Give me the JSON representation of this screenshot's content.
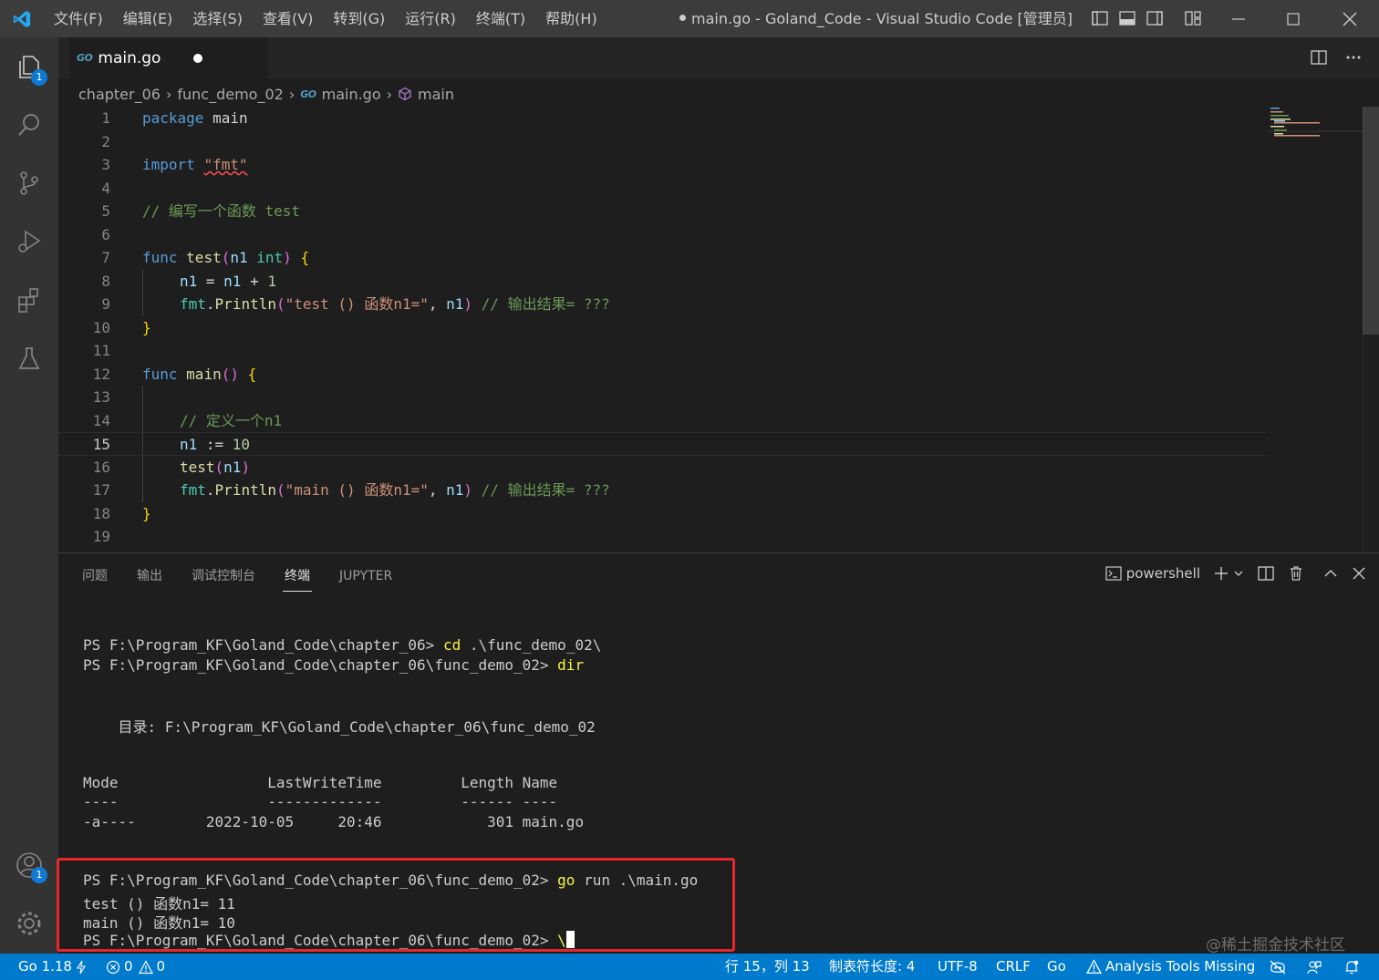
{
  "titlebar": {
    "menus": [
      "文件(F)",
      "编辑(E)",
      "选择(S)",
      "查看(V)",
      "转到(G)",
      "运行(R)",
      "终端(T)",
      "帮助(H)"
    ],
    "window_title": "main.go - Goland_Code - Visual Studio Code [管理员]"
  },
  "activity": {
    "explorer_badge": "1",
    "accounts_badge": "1"
  },
  "tab": {
    "icon_text": "GO",
    "label": "main.go"
  },
  "breadcrumb": {
    "items": [
      "chapter_06",
      "func_demo_02",
      "main.go",
      "main"
    ]
  },
  "code": {
    "line_numbers": [
      "1",
      "2",
      "3",
      "4",
      "5",
      "6",
      "7",
      "8",
      "9",
      "10",
      "11",
      "12",
      "13",
      "14",
      "15",
      "16",
      "17",
      "18",
      "19"
    ],
    "current_line": "15",
    "l1_kw": "package",
    "l1_name": "main",
    "l3_kw": "import",
    "l3_str": "\"fmt\"",
    "l5_comment": "// 编写一个函数 test",
    "l7_kw": "func",
    "l7_fn": "test",
    "l7_p1": "(",
    "l7_var": "n1",
    "l7_ty": "int",
    "l7_p2": ")",
    "l7_brace": "{",
    "l8_var1": "n1",
    "l8_op1": " = ",
    "l8_var2": "n1",
    "l8_op2": " + ",
    "l8_num": "1",
    "l9_pkg": "fmt",
    "l9_dot": ".",
    "l9_fn": "Println",
    "l9_p1": "(",
    "l9_str": "\"test () 函数n1=\"",
    "l9_comma": ", ",
    "l9_var": "n1",
    "l9_p2": ")",
    "l9_comment": "// 输出结果= ???",
    "l10_brace": "}",
    "l12_kw": "func",
    "l12_fn": "main",
    "l12_parens": "()",
    "l12_brace": "{",
    "l14_comment": "// 定义一个n1",
    "l15_var": "n1",
    "l15_op": " := ",
    "l15_num": "10",
    "l16_fn": "test",
    "l16_p1": "(",
    "l16_var": "n1",
    "l16_p2": ")",
    "l17_pkg": "fmt",
    "l17_dot": ".",
    "l17_fn": "Println",
    "l17_p1": "(",
    "l17_str": "\"main () 函数n1=\"",
    "l17_comma": ", ",
    "l17_var": "n1",
    "l17_p2": ")",
    "l17_comment": "// 输出结果= ???",
    "l18_brace": "}"
  },
  "panel": {
    "tabs": [
      "问题",
      "输出",
      "调试控制台",
      "终端",
      "JUPYTER"
    ],
    "active_tab": "终端",
    "shell_label": "powershell"
  },
  "terminal": {
    "l1_prompt": "PS F:\\Program_KF\\Goland_Code\\chapter_06> ",
    "l1_cmd": "cd",
    "l1_arg": " .\\func_demo_02\\",
    "l2_prompt": "PS F:\\Program_KF\\Goland_Code\\chapter_06\\func_demo_02> ",
    "l2_cmd": "dir",
    "dir_line": "    目录: F:\\Program_KF\\Goland_Code\\chapter_06\\func_demo_02",
    "col_header": "Mode                 LastWriteTime         Length Name",
    "col_rule": "----                 -------------         ------ ----",
    "row1": "-a----        2022-10-05     20:46            301 main.go",
    "l3_prompt": "PS F:\\Program_KF\\Goland_Code\\chapter_06\\func_demo_02> ",
    "l3_cmd": "go",
    "l3_arg": " run .\\main.go",
    "out1": "test () 函数n1= 11",
    "out2": "main () 函数n1= 10",
    "l4_prompt": "PS F:\\Program_KF\\Goland_Code\\chapter_06\\func_demo_02> ",
    "l4_typed": "\\"
  },
  "watermark": "@稀土掘金技术社区",
  "statusbar": {
    "go_version": "Go 1.18",
    "errors": "0",
    "warnings": "0",
    "position": "行 15，列 13",
    "indent": "制表符长度: 4",
    "encoding": "UTF-8",
    "eol": "CRLF",
    "language": "Go",
    "analysis": "Analysis Tools Missing"
  },
  "colors": {
    "accent": "#007acc",
    "highlight_box": "#e8262d"
  }
}
